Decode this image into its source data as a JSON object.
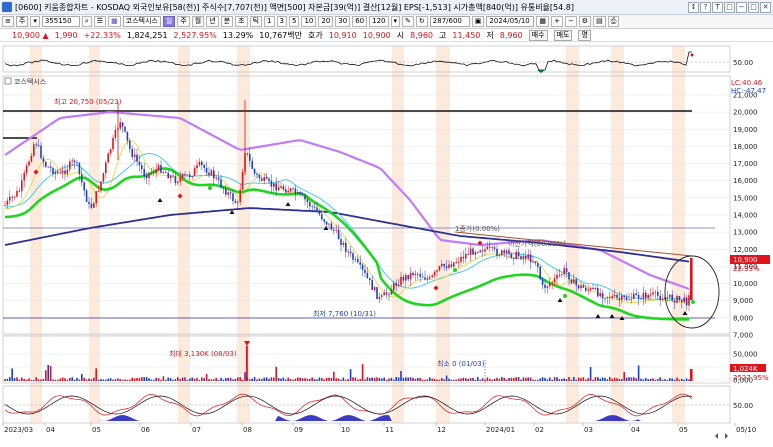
{
  "titlebar": {
    "text": "[0600] 키움종합차트 - KOSDAQ 외국인보유[58(천)] 주식수[7,707(천)] 액면[500] 자본금[39(억)] 결산[12월] EPS[-1,513] 시가총액[840(억)] 유통비율[54.8]",
    "buttons": [
      "↕",
      "?",
      "T",
      "□",
      "−",
      "□",
      "✕"
    ]
  },
  "toolbar": {
    "period_label": "주",
    "code": "355150",
    "stock_name": "코스텍시스",
    "ticks": [
      "일",
      "주",
      "월",
      "년",
      "분",
      "초",
      "틱"
    ],
    "intervals": [
      "1",
      "3",
      "5",
      "10",
      "20",
      "30",
      "60",
      "120"
    ],
    "count": "287/600",
    "date": "2024/05/10"
  },
  "pricebar": {
    "price": "10,900 ▲",
    "change": "1,990",
    "change_pct": "+22.33%",
    "volume": "1,824,251",
    "volume_pct": "2,527.95%",
    "turnover": "13.29%",
    "amount": "10,767백만",
    "bid_label": "호가",
    "bid": "10,910",
    "ask": "10,900",
    "open_label": "시",
    "open": "8,960",
    "high_label": "고",
    "high": "11,450",
    "low_label": "저",
    "low": "8,960",
    "buy_btn": "매수",
    "sell_btn": "매도",
    "extra_btn": "명"
  },
  "top_indicator": {
    "level_label": "50.00"
  },
  "price_panel": {
    "legend": "코스텍시스",
    "lc_label": "LC:40.46",
    "hc_label": "HC:-47.47",
    "high_annotation": "최고 20,750 (05/23)",
    "low_annotation": "최저 7,760 (10/31)",
    "ref_annotation_1": "1종가(0.00%)",
    "ref_annotation_2": "이전가격(00.00%)",
    "current_price": "10,900",
    "current_pct": "22.33%",
    "y_ticks": [
      "21,000",
      "20,000",
      "19,000",
      "18,000",
      "17,000",
      "16,000",
      "15,000",
      "14,000",
      "13,000",
      "12,000",
      "11,000",
      "10,000",
      "9,000",
      "8,000",
      "7,000"
    ],
    "colors": {
      "bull": "#e0121c",
      "bear": "#1d3fc4",
      "ma_green": "#1fd61f",
      "ma_purple": "#c07cf5",
      "ma_navy": "#2e2f8e",
      "ma_yellow": "#e6d94a",
      "ma_cyan": "#32c8e6"
    }
  },
  "volume_panel": {
    "max_annotation": "최대 3,130K (08/03)",
    "min_annotation": "최소 0 (01/03)",
    "y_ticks": [
      "50,000",
      "20,000",
      "0,000"
    ],
    "current_value": "1,024K",
    "current_pct": "2527.95%"
  },
  "osc_panel": {
    "level_label": "50.00"
  },
  "x_axis": {
    "labels": [
      "2023/03",
      "04",
      "05",
      "06",
      "07",
      "08",
      "09",
      "10",
      "11",
      "12",
      "2024/01",
      "02",
      "03",
      "04",
      "05",
      "05/10"
    ]
  }
}
